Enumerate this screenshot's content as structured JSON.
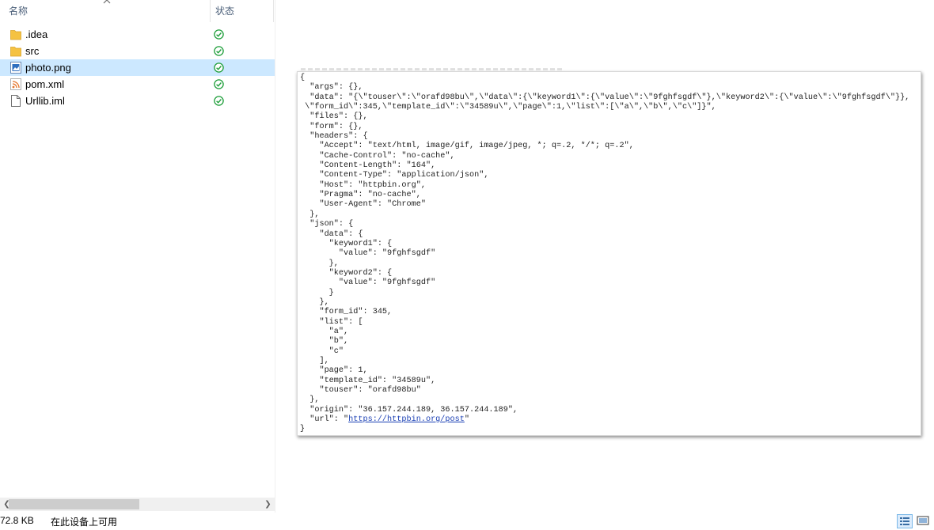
{
  "explorer": {
    "columns": {
      "name": "名称",
      "status": "状态"
    },
    "files": [
      {
        "name": ".idea",
        "icon": "folder-icon",
        "status": "synced-icon",
        "selected": false
      },
      {
        "name": "src",
        "icon": "folder-icon",
        "status": "synced-icon",
        "selected": false
      },
      {
        "name": "photo.png",
        "icon": "image-file-icon",
        "status": "synced-icon",
        "selected": true
      },
      {
        "name": "pom.xml",
        "icon": "xml-file-icon",
        "status": "synced-icon",
        "selected": false
      },
      {
        "name": "Urllib.iml",
        "icon": "document-icon",
        "status": "synced-icon",
        "selected": false
      }
    ]
  },
  "statusbar": {
    "size": "72.8 KB",
    "availability": "在此设备上可用"
  },
  "preview": {
    "json_lines": [
      "{",
      "  \"args\": {},",
      "  \"data\": \"{\\\"touser\\\":\\\"orafd98bu\\\",\\\"data\\\":{\\\"keyword1\\\":{\\\"value\\\":\\\"9fghfsgdf\\\"},\\\"keyword2\\\":{\\\"value\\\":\\\"9fghfsgdf\\\"}},",
      " \\\"form_id\\\":345,\\\"template_id\\\":\\\"34589u\\\",\\\"page\\\":1,\\\"list\\\":[\\\"a\\\",\\\"b\\\",\\\"c\\\"]}\",",
      "  \"files\": {},",
      "  \"form\": {},",
      "  \"headers\": {",
      "    \"Accept\": \"text/html, image/gif, image/jpeg, *; q=.2, */*; q=.2\",",
      "    \"Cache-Control\": \"no-cache\",",
      "    \"Content-Length\": \"164\",",
      "    \"Content-Type\": \"application/json\",",
      "    \"Host\": \"httpbin.org\",",
      "    \"Pragma\": \"no-cache\",",
      "    \"User-Agent\": \"Chrome\"",
      "  },",
      "  \"json\": {",
      "    \"data\": {",
      "      \"keyword1\": {",
      "        \"value\": \"9fghfsgdf\"",
      "      },",
      "      \"keyword2\": {",
      "        \"value\": \"9fghfsgdf\"",
      "      }",
      "    },",
      "    \"form_id\": 345,",
      "    \"list\": [",
      "      \"a\",",
      "      \"b\",",
      "      \"c\"",
      "    ],",
      "    \"page\": 1,",
      "    \"template_id\": \"34589u\",",
      "    \"touser\": \"orafd98bu\"",
      "  },",
      "  \"origin\": \"36.157.244.189, 36.157.244.189\",",
      "  \"url\": \"https://httpbin.org/post\"",
      "}"
    ],
    "url_text": "https://httpbin.org/post"
  },
  "colors": {
    "selection": "#cce8ff",
    "status_green": "#1e9e3a",
    "folder": "#f5c242"
  }
}
